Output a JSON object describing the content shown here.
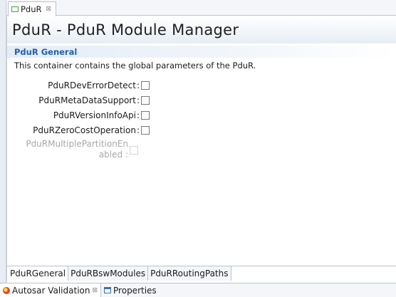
{
  "editor_tab": {
    "label": "PduR",
    "close_glyph": "⊠"
  },
  "page": {
    "title": "PduR - PduR Module Manager",
    "section_title": "PduR General",
    "section_description": "This container contains the global parameters of the PduR."
  },
  "fields": [
    {
      "label": "PduRDevErrorDetect",
      "checked": false,
      "enabled": true
    },
    {
      "label": "PduRMetaDataSupport",
      "checked": false,
      "enabled": true
    },
    {
      "label": "PduRVersionInfoApi",
      "checked": false,
      "enabled": true
    },
    {
      "label": "PduRZeroCostOperation",
      "checked": false,
      "enabled": true
    },
    {
      "label": "PduRMultiplePartitionEnabled",
      "checked": false,
      "enabled": false
    }
  ],
  "multi_label_line1": "PduRMultiplePartitionEn",
  "multi_label_line2": "abled",
  "colon": ":",
  "page_tabs": [
    "PduRGeneral",
    "PduRBswModules",
    "PduRRoutingPaths"
  ],
  "bottom_tabs": {
    "validation": "Autosar Validation",
    "properties": "Properties",
    "close_glyph": "⊠"
  }
}
